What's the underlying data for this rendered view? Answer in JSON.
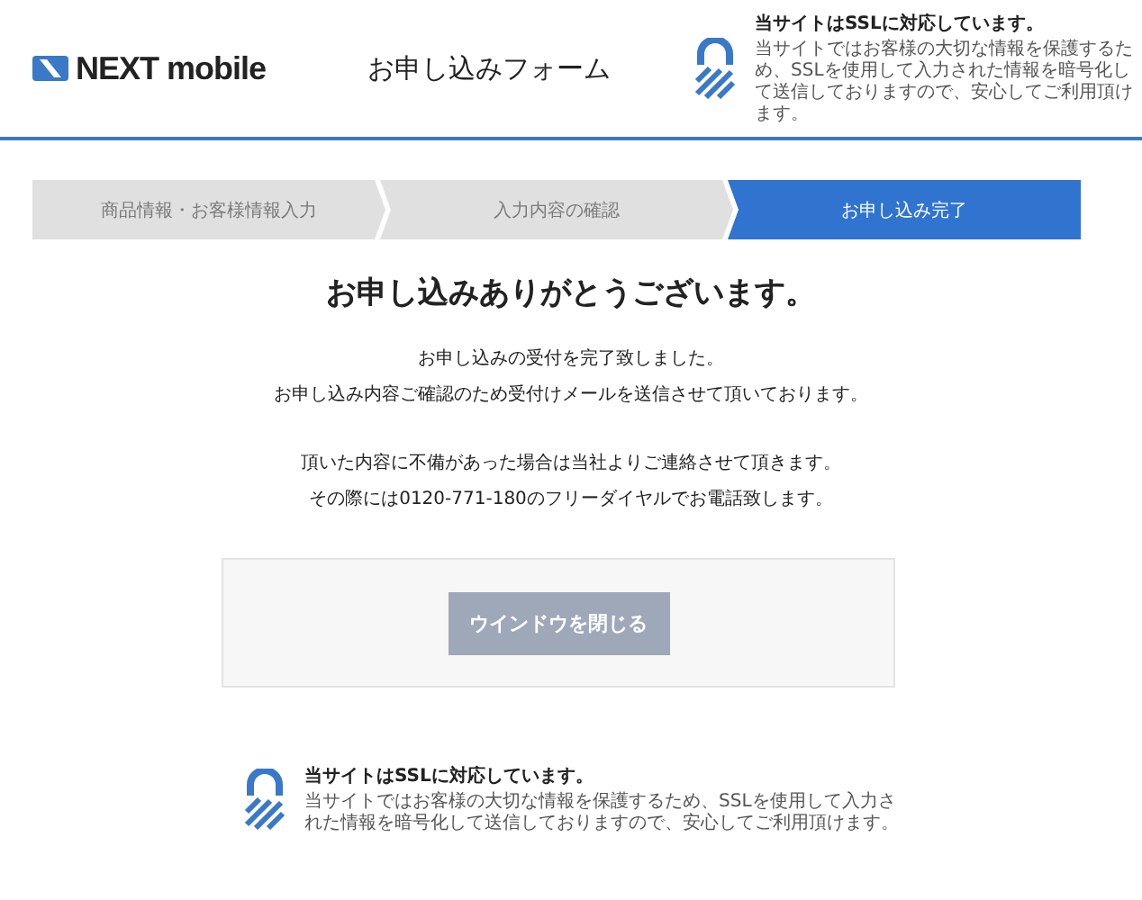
{
  "header": {
    "logo": "NEXT mobile",
    "title": "お申し込みフォーム",
    "ssl_title": "当サイトはSSLに対応しています。",
    "ssl_text": "当サイトではお客様の大切な情報を保護するため、SSLを使用して入力された情報を暗号化して送信しておりますので、安心してご利用頂けます。"
  },
  "steps": [
    {
      "label": "商品情報・お客様情報入力",
      "selected": false
    },
    {
      "label": "入力内容の確認",
      "selected": false
    },
    {
      "label": "お申し込み完了",
      "selected": true
    }
  ],
  "heading": "お申し込みありがとうございます。",
  "paragraphs": [
    [
      "お申し込みの受付を完了致しました。",
      "お申し込み内容ご確認のため受付けメールを送信させて頂いております。"
    ],
    [
      "頂いた内容に不備があった場合は当社よりご連絡させて頂きます。",
      "その際には0120-771-180のフリーダイヤルでお電話致します。"
    ]
  ],
  "close_button": "ウインドウを閉じる",
  "footer": {
    "ssl_title": "当サイトはSSLに対応しています。",
    "ssl_text": "当サイトではお客様の大切な情報を保護するため、SSLを使用して入力された情報を暗号化して送信しておりますので、安心してご利用頂けます。"
  }
}
